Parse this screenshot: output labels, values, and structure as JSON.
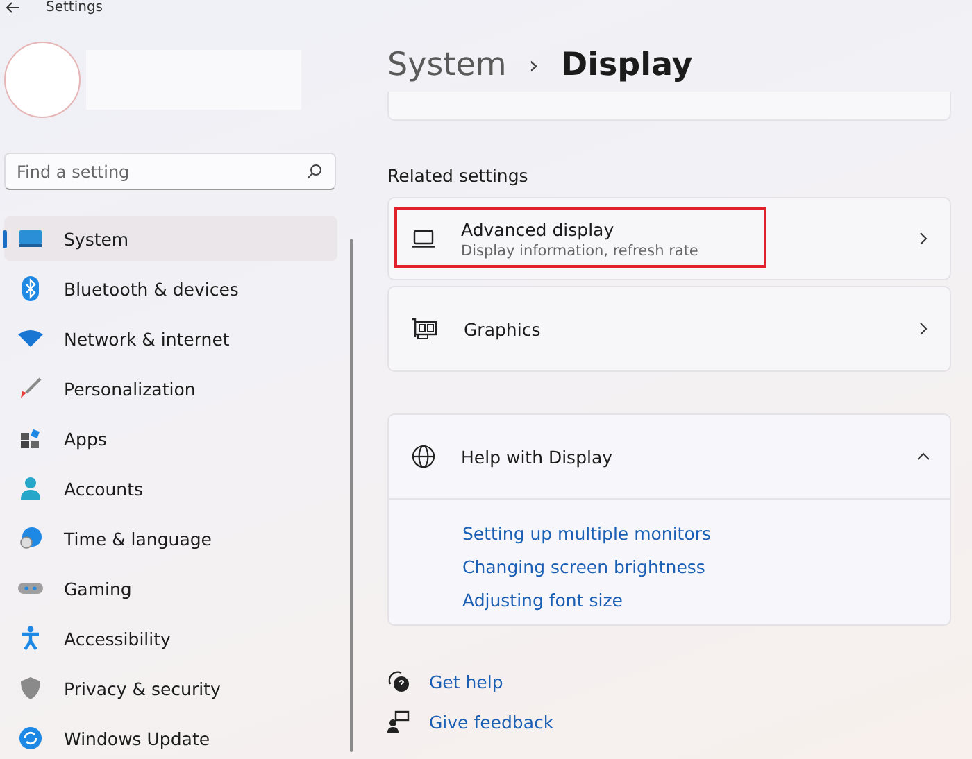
{
  "window": {
    "title": "Settings"
  },
  "search": {
    "placeholder": "Find a setting"
  },
  "sidebar": {
    "items": [
      {
        "label": "System",
        "selected": true
      },
      {
        "label": "Bluetooth & devices",
        "selected": false
      },
      {
        "label": "Network & internet",
        "selected": false
      },
      {
        "label": "Personalization",
        "selected": false
      },
      {
        "label": "Apps",
        "selected": false
      },
      {
        "label": "Accounts",
        "selected": false
      },
      {
        "label": "Time & language",
        "selected": false
      },
      {
        "label": "Gaming",
        "selected": false
      },
      {
        "label": "Accessibility",
        "selected": false
      },
      {
        "label": "Privacy & security",
        "selected": false
      },
      {
        "label": "Windows Update",
        "selected": false
      }
    ]
  },
  "breadcrumb": {
    "parent": "System",
    "separator": "›",
    "current": "Display"
  },
  "related_settings": {
    "heading": "Related settings",
    "items": [
      {
        "title": "Advanced display",
        "subtitle": "Display information, refresh rate",
        "highlighted": true
      },
      {
        "title": "Graphics",
        "highlighted": false
      }
    ]
  },
  "help": {
    "title": "Help with Display",
    "expanded": true,
    "links": [
      "Setting up multiple monitors",
      "Changing screen brightness",
      "Adjusting font size"
    ]
  },
  "footer_links": [
    "Get help",
    "Give feedback"
  ]
}
